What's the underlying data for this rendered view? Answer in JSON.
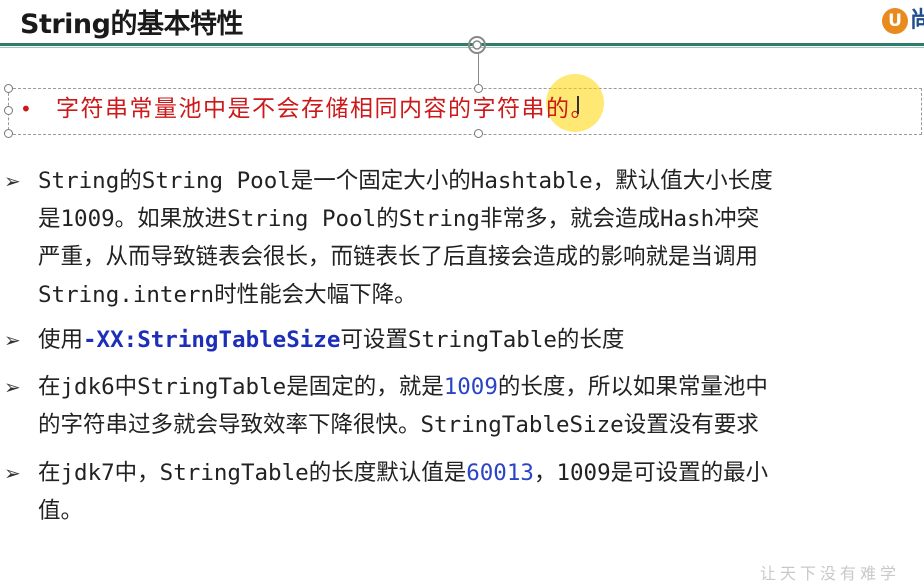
{
  "header": {
    "title": "String的基本特性",
    "logo_letter": "U",
    "logo_text": "尚"
  },
  "callout": {
    "bullet": "•",
    "text": "字符串常量池中是不会存储相同内容的字符串的。"
  },
  "items": [
    {
      "marker": "➢",
      "lines": [
        "String的String Pool是一个固定大小的Hashtable，默认值大小长度",
        "是1009。如果放进String Pool的String非常多，就会造成Hash冲突",
        "严重，从而导致链表会很长，而链表长了后直接会造成的影响就是当调用",
        "String.intern时性能会大幅下降。"
      ]
    },
    {
      "marker": "➢",
      "prefix": "使用",
      "keyword": "-XX:StringTableSize",
      "suffix": "可设置StringTable的长度"
    },
    {
      "marker": "➢",
      "line1_prefix": "在jdk6中StringTable是固定的，就是",
      "line1_num": "1009",
      "line1_suffix": "的长度，所以如果常量池中",
      "line2": "的字符串过多就会导致效率下降很快。StringTableSize设置没有要求"
    },
    {
      "marker": "➢",
      "line1_prefix": "在jdk7中，StringTable的长度默认值是",
      "line1_num": "60013",
      "line1_suffix": "，1009是可设置的最小",
      "line2": "值。"
    }
  ],
  "footer": {
    "watermark": "让天下没有难学"
  },
  "colors": {
    "accent_rule": "#2e7d6b",
    "callout_red": "#cc1a1a",
    "keyword_blue": "#1d2fb8",
    "highlight_yellow": "#ffd600"
  }
}
